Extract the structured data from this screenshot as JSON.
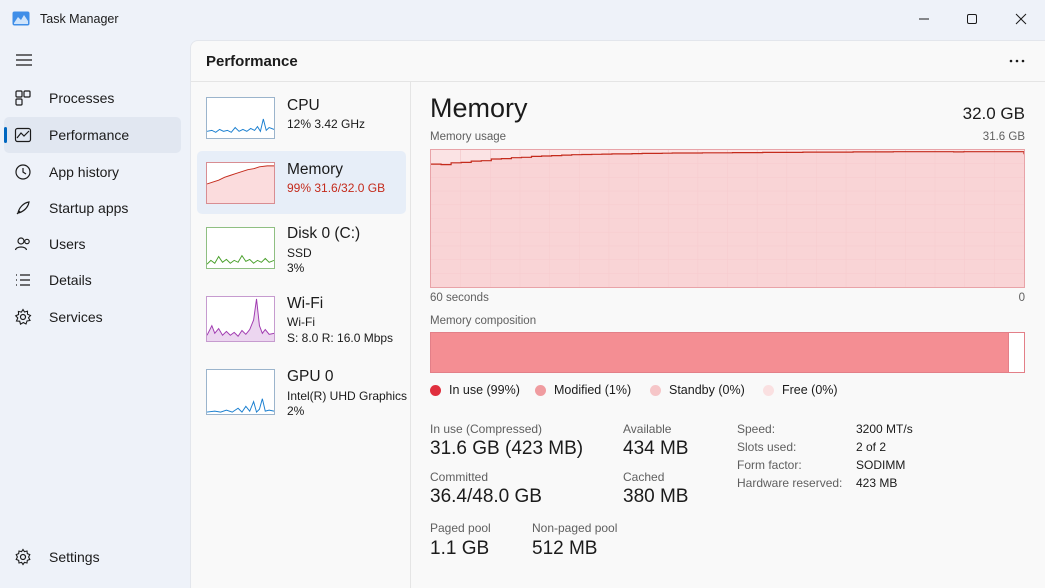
{
  "window": {
    "title": "Task Manager"
  },
  "nav": {
    "items": [
      {
        "label": "Processes",
        "icon": "processes-icon"
      },
      {
        "label": "Performance",
        "icon": "performance-icon",
        "active": true
      },
      {
        "label": "App history",
        "icon": "history-icon"
      },
      {
        "label": "Startup apps",
        "icon": "startup-icon"
      },
      {
        "label": "Users",
        "icon": "users-icon"
      },
      {
        "label": "Details",
        "icon": "details-icon"
      },
      {
        "label": "Services",
        "icon": "services-icon"
      }
    ],
    "settings": {
      "label": "Settings",
      "icon": "settings-icon"
    }
  },
  "page": {
    "title": "Performance"
  },
  "devices": [
    {
      "name": "CPU",
      "lines": [
        "12%  3.42 GHz"
      ],
      "color": "#1a7fd0"
    },
    {
      "name": "Memory",
      "lines": [
        "99%  31.6/32.0 GB"
      ],
      "color": "#c42b1c",
      "active": true
    },
    {
      "name": "Disk 0 (C:)",
      "lines": [
        "SSD",
        "3%"
      ],
      "color": "#4aa02c"
    },
    {
      "name": "Wi-Fi",
      "lines": [
        "Wi-Fi",
        "S: 8.0 R: 16.0 Mbps"
      ],
      "color": "#a03ab0"
    },
    {
      "name": "GPU 0",
      "lines": [
        "Intel(R) UHD Graphics",
        "2%"
      ],
      "color": "#1a7fd0"
    }
  ],
  "memory": {
    "title": "Memory",
    "total": "32.0 GB",
    "usage_label": "Memory usage",
    "usage_max": "31.6 GB",
    "time_left": "60 seconds",
    "time_right": "0",
    "composition_label": "Memory composition",
    "composition_in_use_fraction": 0.975,
    "legend": [
      {
        "label": "In use (99%)",
        "color": "#e02f3e"
      },
      {
        "label": "Modified (1%)",
        "color": "#f09ca0"
      },
      {
        "label": "Standby (0%)",
        "color": "#f6c6c8"
      },
      {
        "label": "Free (0%)",
        "color": "#fae0e1"
      }
    ],
    "stats": {
      "in_use_label": "In use (Compressed)",
      "in_use_value": "31.6 GB (423 MB)",
      "available_label": "Available",
      "available_value": "434 MB",
      "committed_label": "Committed",
      "committed_value": "36.4/48.0 GB",
      "cached_label": "Cached",
      "cached_value": "380 MB",
      "paged_label": "Paged pool",
      "paged_value": "1.1 GB",
      "nonpaged_label": "Non-paged pool",
      "nonpaged_value": "512 MB"
    },
    "specs": [
      {
        "key": "Speed:",
        "value": "3200 MT/s"
      },
      {
        "key": "Slots used:",
        "value": "2 of 2"
      },
      {
        "key": "Form factor:",
        "value": "SODIMM"
      },
      {
        "key": "Hardware reserved:",
        "value": "423 MB"
      }
    ],
    "usage_history_gb": [
      28.7,
      28.6,
      29.0,
      29.1,
      29.4,
      29.5,
      29.9,
      30.0,
      30.2,
      30.3,
      30.5,
      30.6,
      30.7,
      30.8,
      30.9,
      30.95,
      31.0,
      31.05,
      31.1,
      31.1,
      31.15,
      31.2,
      31.2,
      31.25,
      31.3,
      31.3,
      31.3,
      31.35,
      31.35,
      31.35,
      31.4,
      31.4,
      31.4,
      31.45,
      31.45,
      31.45,
      31.45,
      31.5,
      31.5,
      31.5,
      31.5,
      31.5,
      31.55,
      31.55,
      31.55,
      31.55,
      31.6,
      31.6,
      31.6,
      31.6,
      31.6,
      31.6,
      31.55,
      31.6,
      31.6,
      31.6,
      31.6,
      31.6,
      31.6,
      31.0
    ]
  }
}
